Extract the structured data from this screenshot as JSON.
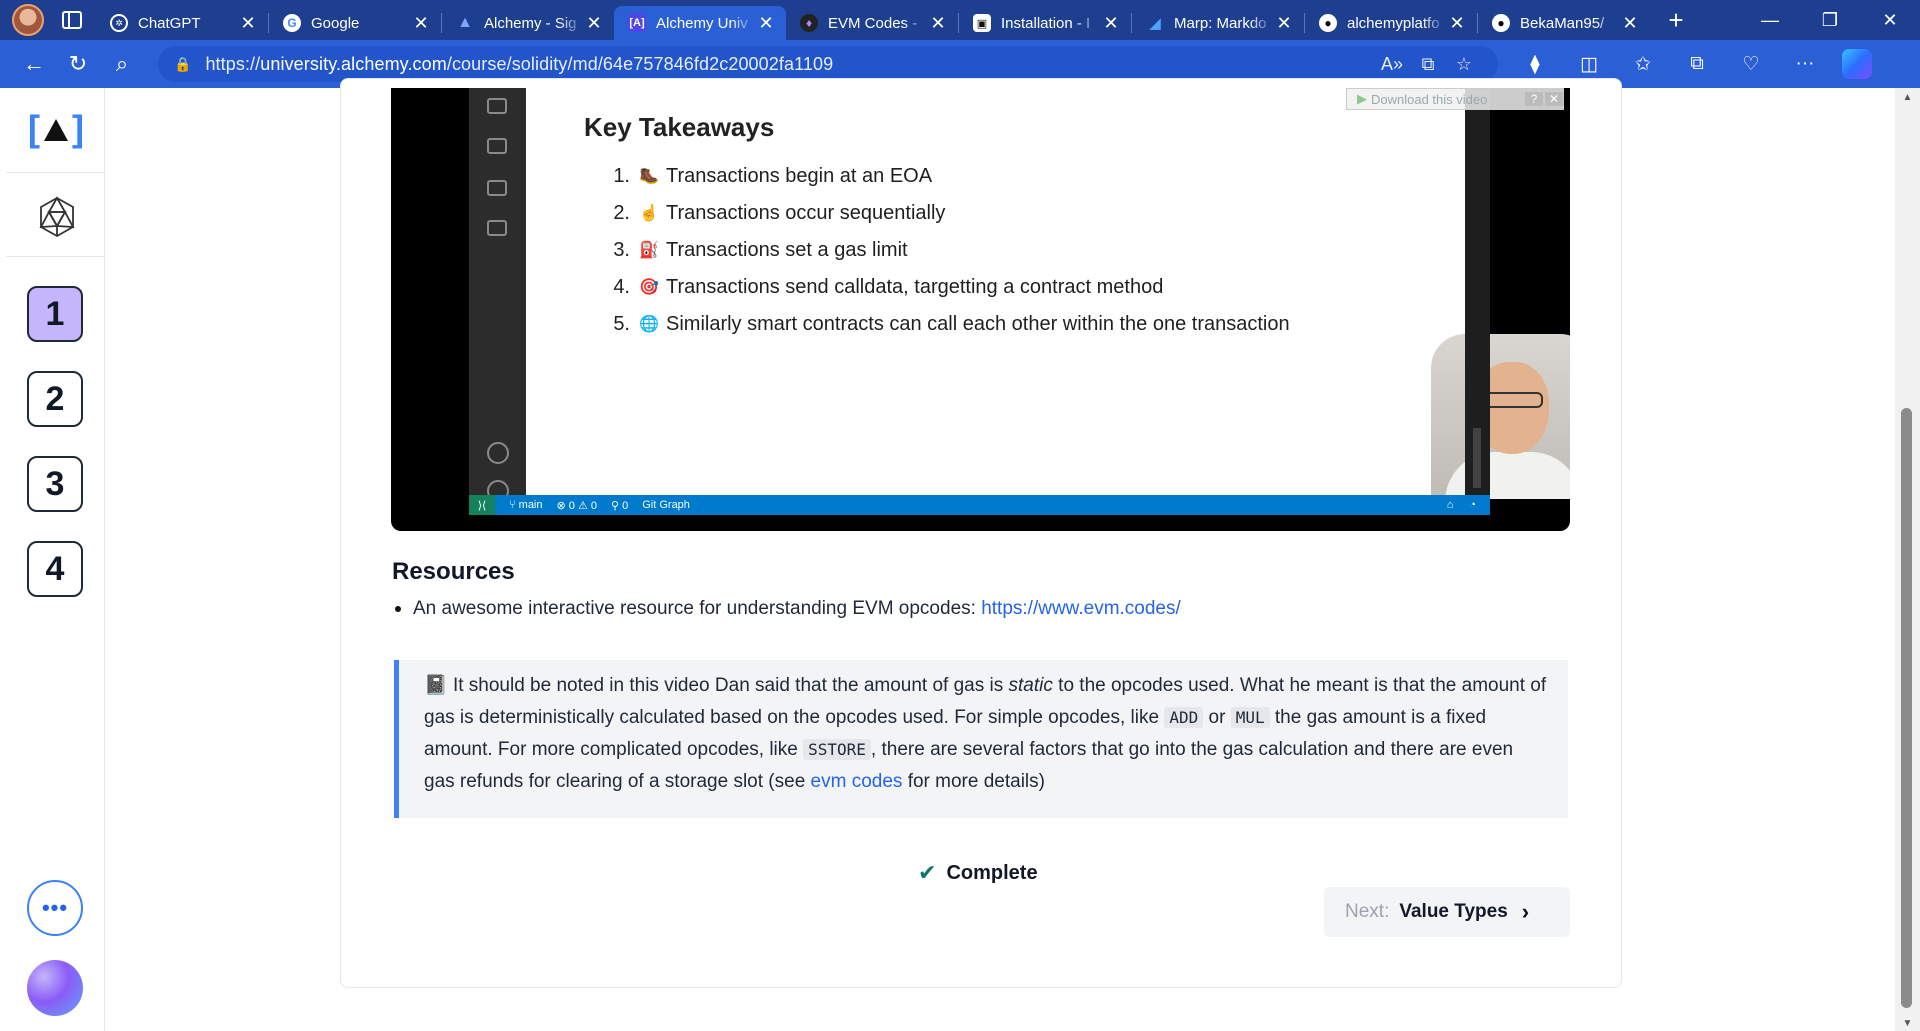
{
  "browser": {
    "tabs": [
      {
        "title": "ChatGPT",
        "favicon": "chatgpt-icon",
        "active": false
      },
      {
        "title": "Google",
        "favicon": "google-icon",
        "active": false
      },
      {
        "title": "Alchemy - Sig",
        "favicon": "alchemy-icon",
        "active": false
      },
      {
        "title": "Alchemy Univ",
        "favicon": "alchemy-university-icon",
        "active": true
      },
      {
        "title": "EVM Codes -",
        "favicon": "evm-codes-icon",
        "active": false
      },
      {
        "title": "Installation - I",
        "favicon": "installation-icon",
        "active": false
      },
      {
        "title": "Marp: Markdo",
        "favicon": "marp-icon",
        "active": false
      },
      {
        "title": "alchemyplatfo",
        "favicon": "github-icon",
        "active": false
      },
      {
        "title": "BekaMan95/",
        "favicon": "github-icon",
        "active": false
      }
    ],
    "url_prefix": "https://",
    "url_host": "university.alchemy.com",
    "url_path": "/course/solidity/md/64e757846fd2c20002fa1109"
  },
  "leftnav": {
    "brand_open": "[",
    "brand_close": "]",
    "lessons": [
      "1",
      "2",
      "3",
      "4"
    ],
    "active_lesson": "1",
    "more_label": "•••"
  },
  "video": {
    "download_label": "Download this video",
    "slide_title": "Key Takeaways",
    "takeaways": [
      {
        "num": "1.",
        "emoji": "🥾",
        "text": "Transactions begin at an EOA"
      },
      {
        "num": "2.",
        "emoji": "☝️",
        "text": "Transactions occur sequentially"
      },
      {
        "num": "3.",
        "emoji": "⛽",
        "text": "Transactions set a gas limit"
      },
      {
        "num": "4.",
        "emoji": "🎯",
        "text": "Transactions send calldata, targetting a contract method"
      },
      {
        "num": "5.",
        "emoji": "🌐",
        "text": "Similarly smart contracts can call each other within the one transaction"
      }
    ],
    "statusbar": {
      "branch": "main",
      "problems": "⊗ 0 ⚠ 0",
      "ports": "0",
      "git_graph": "Git Graph"
    }
  },
  "resources": {
    "title": "Resources",
    "item_text": "An awesome interactive resource for understanding EVM opcodes: ",
    "item_link": "https://www.evm.codes/"
  },
  "note": {
    "emoji": "📓",
    "p1": " It should be noted in this video Dan said that the amount of gas is ",
    "em": "static",
    "p2": " to the opcodes used. What he meant is that the amount of gas is deterministically calculated based on the opcodes used. For simple opcodes, like ",
    "code1": "ADD",
    "p3": " or ",
    "code2": "MUL",
    "p4": " the gas amount is a fixed amount. For more complicated opcodes, like ",
    "code3": "SSTORE",
    "p5": ", there are several factors that go into the gas calculation and there are even gas refunds for clearing of a storage slot (see ",
    "link": "evm codes",
    "p6": " for more details)"
  },
  "complete_label": "Complete",
  "next": {
    "label": "Next:",
    "title": "Value Types"
  },
  "colors": {
    "accent": "#2b5fd6",
    "link": "#2563eb",
    "active_lesson": "#c4b5fd",
    "complete_check": "#0f766e"
  }
}
